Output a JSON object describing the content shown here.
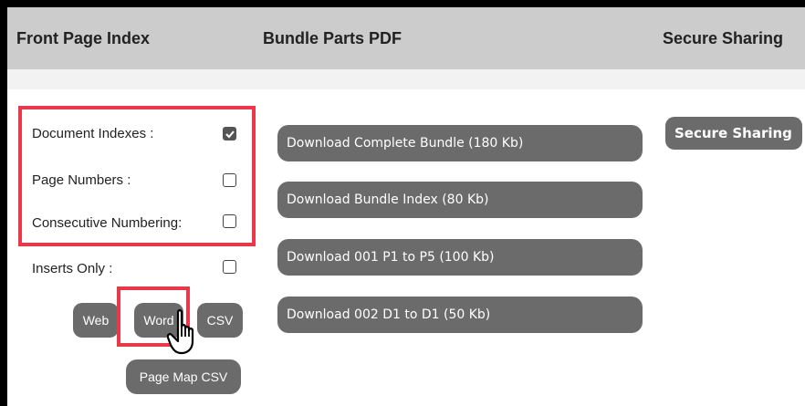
{
  "header": {
    "col1_title": "Front Page Index",
    "col2_title": "Bundle Parts PDF",
    "col3_title": "Secure Sharing"
  },
  "index_options": [
    {
      "label": "Document Indexes :",
      "checked": true
    },
    {
      "label": "Page Numbers :",
      "checked": false
    },
    {
      "label": "Consecutive Numbering:",
      "checked": false
    },
    {
      "label": "Inserts Only :",
      "checked": false
    }
  ],
  "export_buttons": {
    "web": "Web",
    "word": "Word",
    "csv": "CSV",
    "page_map_csv": "Page Map CSV"
  },
  "downloads": [
    "Download Complete Bundle (180 Kb)",
    "Download Bundle Index (80 Kb)",
    "Download 001 P1 to P5 (100 Kb)",
    "Download 002 D1 to D1 (50 Kb)"
  ],
  "secure_sharing_button": "Secure Sharing",
  "colors": {
    "header_bg": "#cccccc",
    "button_bg": "#6b6b6b",
    "highlight": "#e8384a"
  }
}
